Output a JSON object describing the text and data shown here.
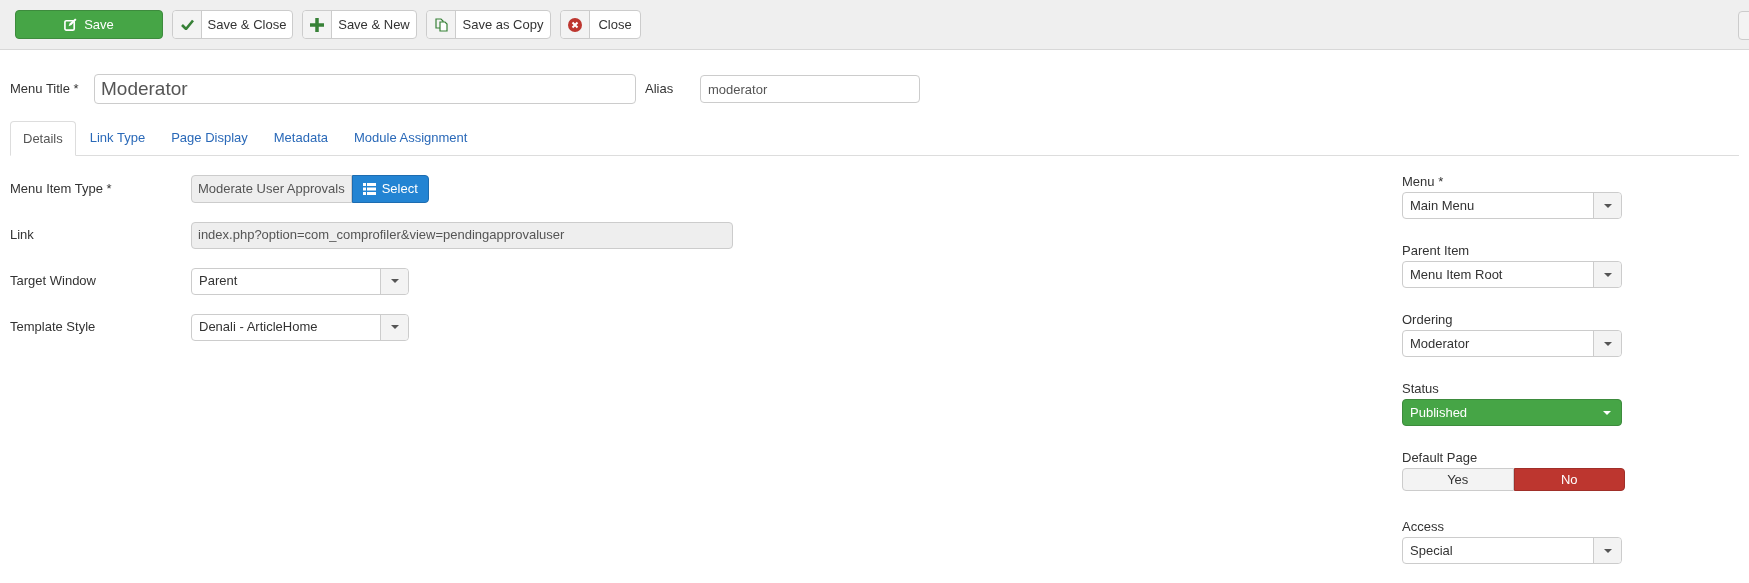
{
  "toolbar": {
    "buttons": [
      {
        "label": "Save",
        "kind": "primary"
      },
      {
        "label": "Save & Close",
        "kind": "default"
      },
      {
        "label": "Save & New",
        "kind": "default"
      },
      {
        "label": "Save as Copy",
        "kind": "default"
      },
      {
        "label": "Close",
        "kind": "default"
      }
    ]
  },
  "title_row": {
    "menu_title": {
      "label": "Menu Title *",
      "value": "Moderator"
    },
    "alias": {
      "label": "Alias",
      "value": "moderator"
    }
  },
  "tabs": [
    {
      "label": "Details",
      "selected": true
    },
    {
      "label": "Link Type",
      "selected": false
    },
    {
      "label": "Page Display",
      "selected": false
    },
    {
      "label": "Metadata",
      "selected": false
    },
    {
      "label": "Module Assignment",
      "selected": false
    }
  ],
  "details": [
    {
      "label": "Menu Item Type *",
      "kind": "picker",
      "value": "Moderate User Approvals",
      "button": "Select"
    },
    {
      "label": "Link",
      "kind": "readonly",
      "value": "index.php?option=com_comprofiler&view=pendingapprovaluser"
    },
    {
      "label": "Target Window",
      "kind": "select",
      "value": "Parent"
    },
    {
      "label": "Template Style",
      "kind": "select",
      "value": "Denali - ArticleHome"
    }
  ],
  "sidebar": [
    {
      "label": "Menu *",
      "kind": "select",
      "value": "Main Menu"
    },
    {
      "label": "Parent Item",
      "kind": "select",
      "value": "Menu Item Root"
    },
    {
      "label": "Ordering",
      "kind": "select",
      "value": "Moderator"
    },
    {
      "label": "Status",
      "kind": "status",
      "value": "Published"
    },
    {
      "label": "Default Page",
      "kind": "toggle",
      "options": [
        {
          "label": "Yes",
          "selected": false
        },
        {
          "label": "No",
          "selected": true
        }
      ]
    },
    {
      "label": "Access",
      "kind": "select",
      "value": "Special"
    }
  ]
}
